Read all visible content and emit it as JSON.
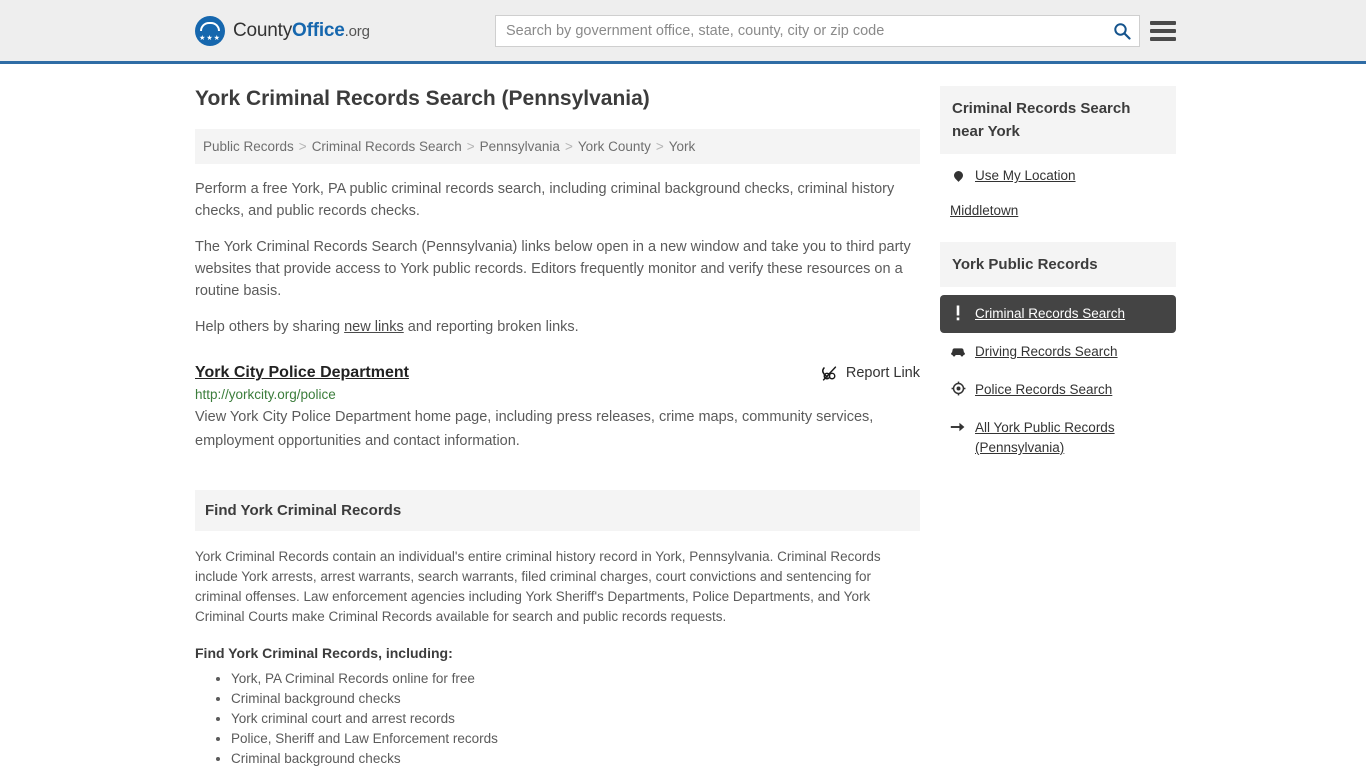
{
  "header": {
    "brand_first": "County",
    "brand_bold": "Office",
    "brand_tld": ".org",
    "search_placeholder": "Search by government office, state, county, city or zip code",
    "search_value": "",
    "search_icon": "search-icon",
    "menu_icon": "hamburger-menu-icon",
    "accent_color": "#2f6ca5",
    "brand_blue": "#1667ae"
  },
  "main": {
    "title": "York Criminal Records Search (Pennsylvania)",
    "breadcrumb": [
      "Public Records",
      "Criminal Records Search",
      "Pennsylvania",
      "York County",
      "York"
    ],
    "breadcrumb_separator": ">",
    "intro_1": "Perform a free York, PA public criminal records search, including criminal background checks, criminal history checks, and public records checks.",
    "intro_2": "The York Criminal Records Search (Pennsylvania) links below open in a new window and take you to third party websites that provide access to York public records. Editors frequently monitor and verify these resources on a routine basis.",
    "help_prefix": "Help others by sharing ",
    "help_link": "new links",
    "help_suffix": " and reporting broken links.",
    "listing": {
      "title": "York City Police Department",
      "report_label": "Report Link",
      "report_icon": "broken-link-icon",
      "url": "http://yorkcity.org/police",
      "url_color": "#3b7d3b",
      "description": "View York City Police Department home page, including press releases, crime maps, community services, employment opportunities and contact information."
    },
    "find_section": {
      "heading": "Find York Criminal Records",
      "body": "York Criminal Records contain an individual's entire criminal history record in York, Pennsylvania. Criminal Records include York arrests, arrest warrants, search warrants, filed criminal charges, court convictions and sentencing for criminal offenses. Law enforcement agencies including York Sheriff's Departments, Police Departments, and York Criminal Courts make Criminal Records available for search and public records requests.",
      "sub_heading": "Find York Criminal Records, including:",
      "bullets": [
        "York, PA Criminal Records online for free",
        "Criminal background checks",
        "York criminal court and arrest records",
        "Police, Sheriff and Law Enforcement records",
        "Criminal background checks"
      ]
    }
  },
  "sidebar": {
    "near_card": {
      "heading": "Criminal Records Search near York",
      "use_location_label": "Use My Location",
      "use_location_icon": "map-pin-icon",
      "places": [
        "Middletown"
      ]
    },
    "records_card": {
      "heading": "York Public Records",
      "items": [
        {
          "label": "Criminal Records Search",
          "icon": "exclamation-mark-icon",
          "active": true
        },
        {
          "label": "Driving Records Search",
          "icon": "car-icon",
          "active": false
        },
        {
          "label": "Police Records Search",
          "icon": "target-badge-icon",
          "active": false
        },
        {
          "label": "All York Public Records (Pennsylvania)",
          "icon": "arrow-right-icon",
          "active": false
        }
      ],
      "active_bg": "#444444"
    }
  }
}
